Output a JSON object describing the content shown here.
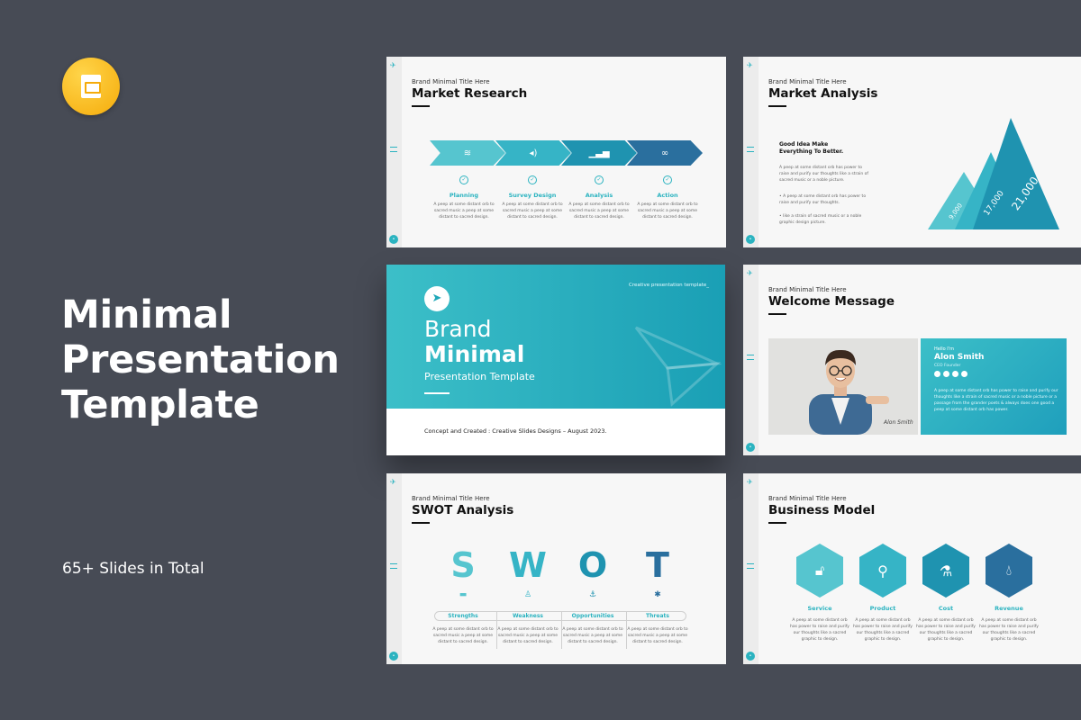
{
  "hero": {
    "line1": "Minimal",
    "line2": "Presentation",
    "line3": "Template",
    "slides_count": "65+ Slides in Total"
  },
  "colors": {
    "background": "#474b55",
    "accent": "#2bb3c0",
    "dark_accent": "#2a6f9e"
  },
  "common": {
    "kicker": "Brand Minimal Title Here",
    "tiny_text": "A peep at some distant orb to sacred music a peep at some distant to sacred design."
  },
  "slide1": {
    "title": "Market Research",
    "stages": [
      {
        "label": "Planning",
        "icon": "layers-icon",
        "color": "#56c5cf"
      },
      {
        "label": "Survey Design",
        "icon": "speaker-icon",
        "color": "#36b4c6"
      },
      {
        "label": "Analysis",
        "icon": "bar-chart-icon",
        "color": "#1f93b0"
      },
      {
        "label": "Action",
        "icon": "binoculars-icon",
        "color": "#2a6f9e"
      }
    ]
  },
  "slide2": {
    "title": "Market Analysis",
    "heading": "Good Idea Make Everything To Better.",
    "paragraph": "A peep at some distant orb has power to raise and purify our thoughts like a strain of sacred music or a noble picture.",
    "bullet1": "A peep at some distant orb has power to raise and purify our thoughts.",
    "bullet2": "like a strain of sacred music or a noble graphic design picture.",
    "values": [
      "9,000",
      "17,000",
      "21,000"
    ]
  },
  "slide3": {
    "tag": "Creative presentation template_",
    "brand": "Brand",
    "minimal": "Minimal",
    "subtitle": "Presentation Template",
    "footer": "Concept and Created : Creative Slides Designs – August 2023."
  },
  "slide4": {
    "title": "Welcome Message",
    "hello": "Hello I'm",
    "name": "Alon Smith",
    "role": "CEO Founder",
    "body": "A peep at some distant orb has power to raise and purify our thoughts like a strain of sacred music or a noble picture or a passage from the grander poets & always does one good a peep at some distant orb has power.",
    "signature": "Alon Smith"
  },
  "slide5": {
    "title": "SWOT Analysis",
    "letters": [
      "S",
      "W",
      "O",
      "T"
    ],
    "labels": [
      "Strengths",
      "Weakness",
      "Opportunities",
      "Threats"
    ],
    "colors": [
      "#56c5cf",
      "#36b4c6",
      "#1f93b0",
      "#2a6f9e"
    ]
  },
  "slide6": {
    "title": "Business Model",
    "items": [
      {
        "label": "Service",
        "icon": "lock-icon",
        "color": "#56c5cf"
      },
      {
        "label": "Product",
        "icon": "magnifier-icon",
        "color": "#36b4c6"
      },
      {
        "label": "Cost",
        "icon": "flask-icon",
        "color": "#1f93b0"
      },
      {
        "label": "Revenue",
        "icon": "drops-icon",
        "color": "#2a6f9e"
      }
    ],
    "tiny_text": "A peep at some distant orb has power to raise and purify our thoughts like a sacred graphic to design."
  }
}
